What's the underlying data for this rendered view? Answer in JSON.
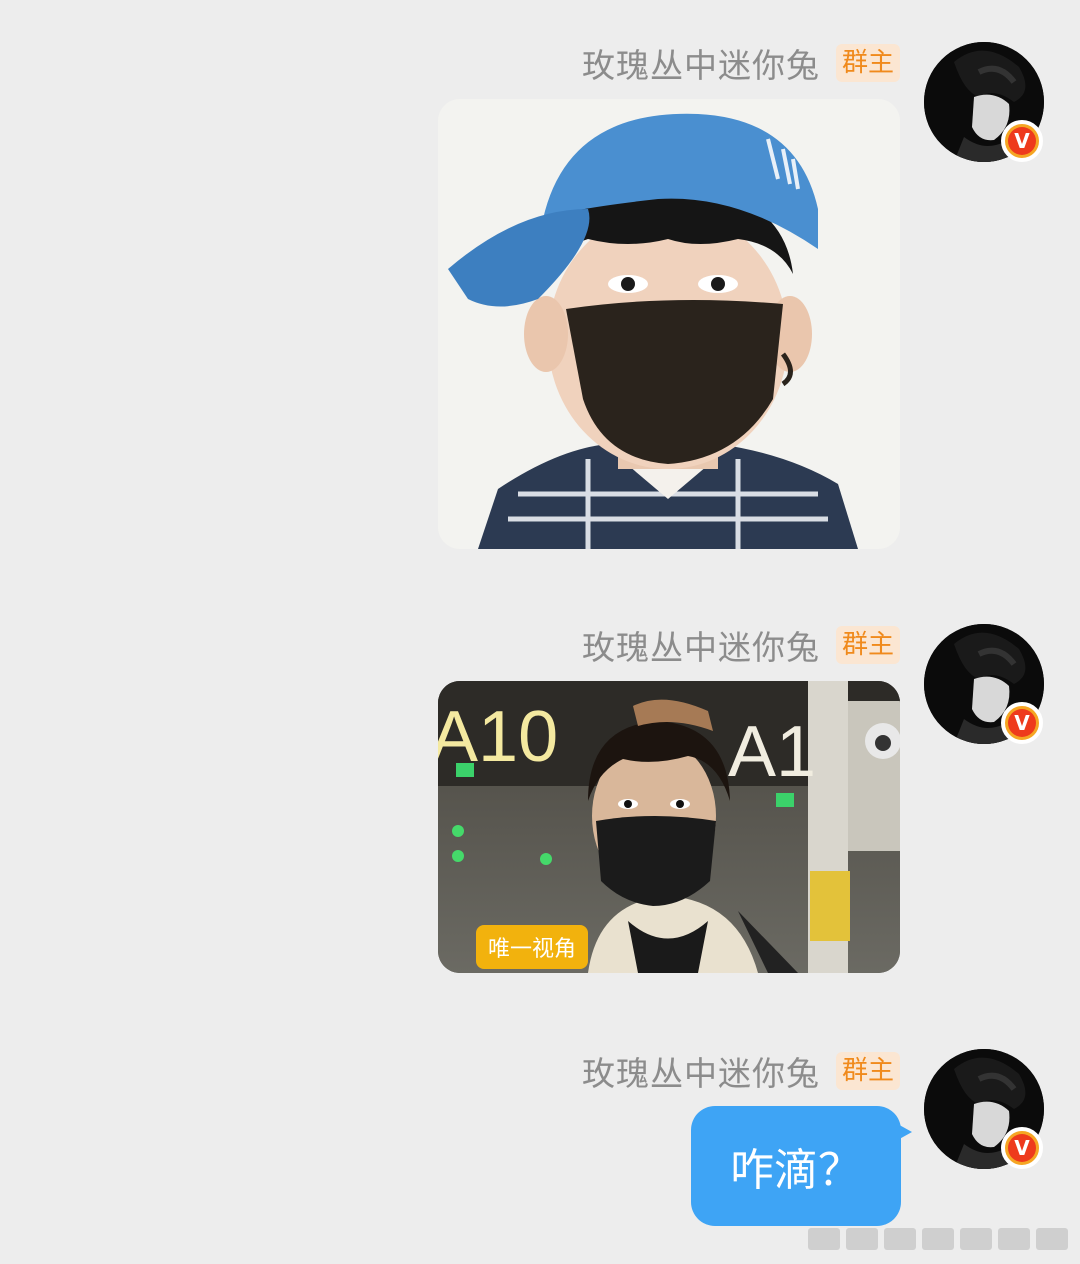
{
  "messages": [
    {
      "sender": "玫瑰丛中迷你兔",
      "role_badge": "群主",
      "type": "image",
      "image_desc": "boy-blue-cap-black-mask"
    },
    {
      "sender": "玫瑰丛中迷你兔",
      "role_badge": "群主",
      "type": "image",
      "image_desc": "boy-airport-black-mask",
      "image_signs": [
        "A10",
        "A1"
      ],
      "image_tag": "唯一视角"
    },
    {
      "sender": "玫瑰丛中迷你兔",
      "role_badge": "群主",
      "type": "text",
      "text": "咋滴？"
    }
  ],
  "avatar": {
    "badge_letter": "V",
    "badge_color": "#f5a623",
    "badge_inner_color": "#ee3a1c"
  },
  "colors": {
    "background": "#ededed",
    "bubble": "#3ea4f5",
    "badge_text": "#f08a1c",
    "badge_bg": "#fbe6d2"
  }
}
